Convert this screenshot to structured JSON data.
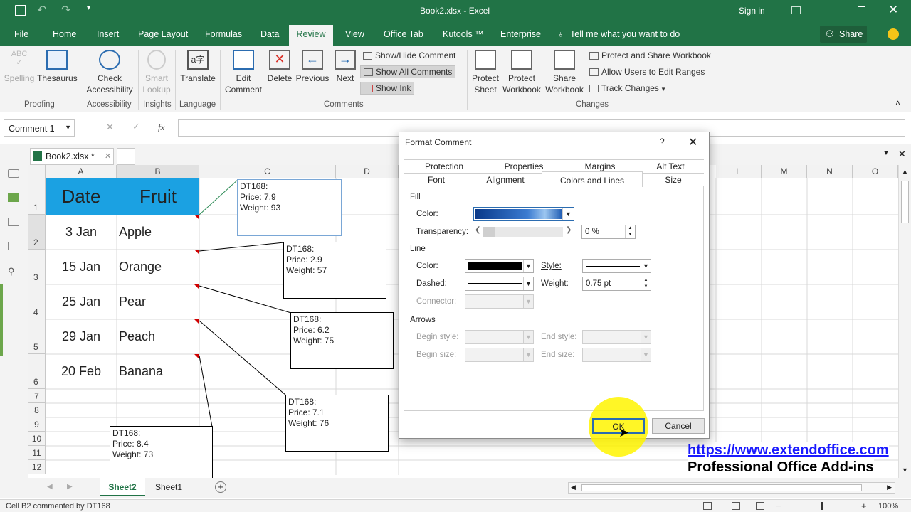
{
  "titlebar": {
    "title": "Book2.xlsx  -  Excel",
    "signin": "Sign in"
  },
  "menu": {
    "items": [
      "File",
      "Home",
      "Insert",
      "Page Layout",
      "Formulas",
      "Data",
      "Review",
      "View",
      "Office Tab",
      "Kutools ™",
      "Enterprise"
    ],
    "tell": "Tell me what you want to do",
    "share": "Share"
  },
  "ribbon": {
    "spelling": "Spelling",
    "thesaurus": "Thesaurus",
    "check": "Check",
    "accessibility": "Accessibility",
    "smart": "Smart",
    "lookup": "Lookup",
    "translate": "Translate",
    "edit": "Edit",
    "comment": "Comment",
    "delete": "Delete",
    "previous": "Previous",
    "next": "Next",
    "show_hide": "Show/Hide Comment",
    "show_all": "Show All Comments",
    "show_ink": "Show Ink",
    "protect": "Protect",
    "sheet": "Sheet",
    "workbook": "Workbook",
    "share_btn": "Share",
    "protect_share": "Protect and Share Workbook",
    "allow_users": "Allow Users to Edit Ranges",
    "track": "Track Changes",
    "groups": [
      "Proofing",
      "Accessibility",
      "Insights",
      "Language",
      "Comments",
      "Changes"
    ]
  },
  "namebox": "Comment 1",
  "fx": "fx",
  "doc_tab": "Book2.xlsx *",
  "columns": [
    "A",
    "B",
    "C",
    "D",
    "L",
    "M",
    "N",
    "O"
  ],
  "rows": [
    "1",
    "2",
    "3",
    "4",
    "5",
    "6",
    "7",
    "8",
    "9",
    "10",
    "11",
    "12"
  ],
  "table": {
    "header": [
      "Date",
      "Fruit"
    ],
    "data": [
      [
        "3 Jan",
        "Apple"
      ],
      [
        "15 Jan",
        "Orange"
      ],
      [
        "25 Jan",
        "Pear"
      ],
      [
        "29 Jan",
        "Peach"
      ],
      [
        "20 Feb",
        "Banana"
      ]
    ]
  },
  "comments": [
    {
      "l1": "DT168:",
      "l2": "Price: 7.9",
      "l3": "Weight: 93"
    },
    {
      "l1": "DT168:",
      "l2": "Price: 2.9",
      "l3": "Weight: 57"
    },
    {
      "l1": "DT168:",
      "l2": "Price: 6.2",
      "l3": "Weight: 75"
    },
    {
      "l1": "DT168:",
      "l2": "Price: 7.1",
      "l3": "Weight: 76"
    },
    {
      "l1": "DT168:",
      "l2": "Price: 8.4",
      "l3": "Weight: 73"
    }
  ],
  "dialog": {
    "title": "Format Comment",
    "help": "?",
    "tabs_row1": [
      "Protection",
      "Properties",
      "Margins",
      "Alt Text"
    ],
    "tabs_row2": [
      "Font",
      "Alignment",
      "Colors and Lines",
      "Size"
    ],
    "fill": "Fill",
    "color": "Color:",
    "transparency": "Transparency:",
    "trans_val": "0 %",
    "line": "Line",
    "line_color": "Color:",
    "style": "Style:",
    "dashed": "Dashed:",
    "weight": "Weight:",
    "weight_val": "0.75 pt",
    "connector": "Connector:",
    "arrows": "Arrows",
    "begin_style": "Begin style:",
    "end_style": "End style:",
    "begin_size": "Begin size:",
    "end_size": "End size:",
    "ok": "OK",
    "cancel": "Cancel"
  },
  "sheets": [
    "Sheet2",
    "Sheet1"
  ],
  "status": "Cell B2 commented by DT168",
  "zoom": "100%",
  "watermark": {
    "url": "https://www.extendoffice.com",
    "tag": "Professional Office Add-ins"
  }
}
